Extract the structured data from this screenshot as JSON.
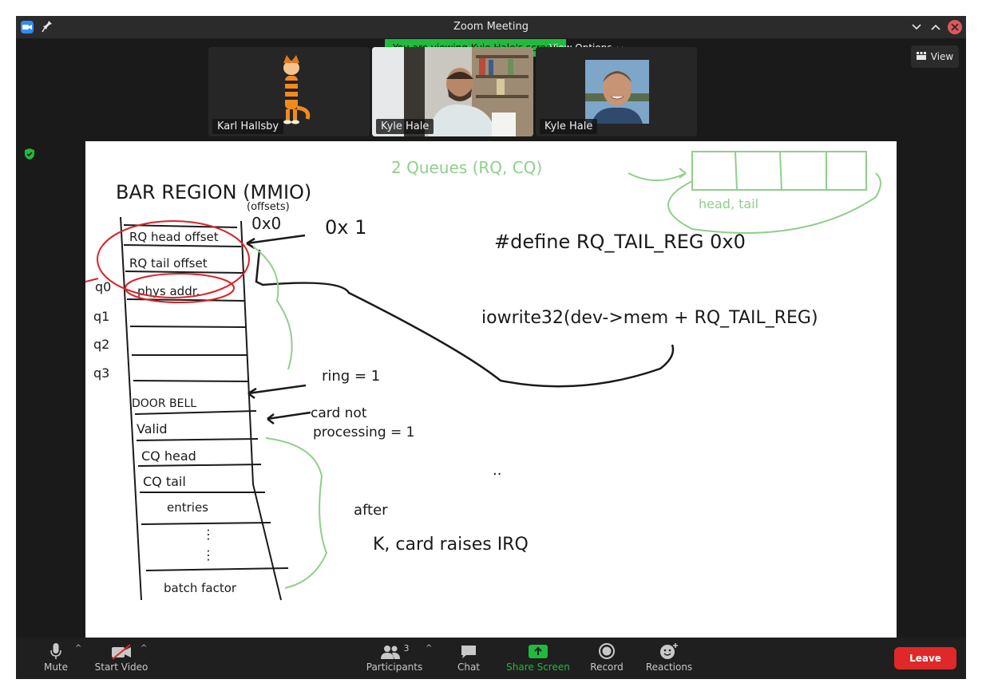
{
  "window": {
    "title": "Zoom Meeting"
  },
  "banner": {
    "text": "You are viewing Kyle Hale's screen",
    "view_options": "View Options"
  },
  "view_button": {
    "label": "View"
  },
  "participants_strip": [
    {
      "name": "Karl Hallsby"
    },
    {
      "name": "Kyle Hale"
    },
    {
      "name": "Kyle Hale"
    }
  ],
  "whiteboard": {
    "bar_region": "BAR REGION (MMIO)",
    "offsets": "(offsets)",
    "offset_0x0": "0x0",
    "cell_rq_head": "RQ head offset",
    "cell_rq_tail": "RQ tail offset",
    "cell_phys": "phys addr.",
    "q_labels": [
      "q0",
      "q1",
      "q2",
      "q3"
    ],
    "cell_doorbell": "DOOR BELL",
    "cell_valid": "Valid",
    "cell_cq_head": "CQ head",
    "cell_cq_tail": "CQ tail",
    "cell_entries": "entries",
    "cell_batch": "batch factor",
    "two_queues": "2 Queues (RQ, CQ)",
    "head_tail": "head, tail",
    "ox_one": "0x 1",
    "define": "#define RQ_TAIL_REG 0x0",
    "iowrite": "iowrite32(dev->mem + RQ_TAIL_REG)",
    "ring": "ring = 1",
    "card_not": "card not",
    "processing": "processing = 1",
    "dots": "..",
    "after": "after",
    "raise": "K, card raises IRQ"
  },
  "toolbar": {
    "mute": "Mute",
    "start_video": "Start Video",
    "participants": "Participants",
    "participants_count": "3",
    "chat": "Chat",
    "share_screen": "Share Screen",
    "record": "Record",
    "reactions": "Reactions",
    "leave": "Leave"
  },
  "colors": {
    "share_green": "#1fbb3c",
    "leave_red": "#e02828",
    "ink_red": "#d9232a",
    "ink_green": "#8fcf8a",
    "ink_black": "#1a1a1a"
  },
  "icons": [
    "zoom-logo-icon",
    "pin-icon",
    "chevron-down-icon",
    "chevron-up-icon",
    "close-icon",
    "grid-view-icon",
    "shield-icon",
    "microphone-icon",
    "video-off-icon",
    "participants-icon",
    "chat-icon",
    "share-screen-icon",
    "record-icon",
    "reactions-icon"
  ]
}
